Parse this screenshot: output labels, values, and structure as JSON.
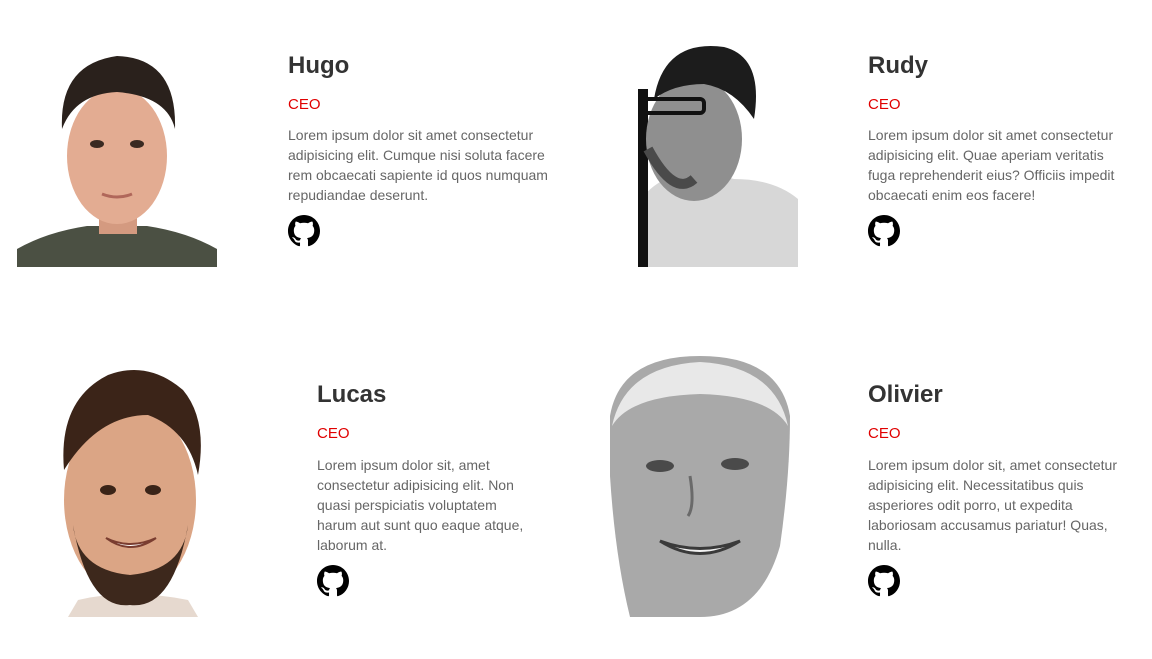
{
  "members": [
    {
      "name": "Hugo",
      "role": "CEO",
      "bio": "Lorem ipsum dolor sit amet consectetur adipisicing elit. Cumque nisi soluta facere rem obcaecati sapiente id quos numquam repudiandae deserunt.",
      "photo_alt": "Hugo portrait",
      "link_icon": "github-icon"
    },
    {
      "name": "Rudy",
      "role": "CEO",
      "bio": "Lorem ipsum dolor sit amet consectetur adipisicing elit. Quae aperiam veritatis fuga reprehenderit eius? Officiis impedit obcaecati enim eos facere!",
      "photo_alt": "Rudy portrait",
      "link_icon": "github-icon"
    },
    {
      "name": "Lucas",
      "role": "CEO",
      "bio": "Lorem ipsum dolor sit, amet consectetur adipisicing elit. Non quasi perspiciatis voluptatem harum aut sunt quo eaque atque, laborum at.",
      "photo_alt": "Lucas portrait",
      "link_icon": "github-icon"
    },
    {
      "name": "Olivier",
      "role": "CEO",
      "bio": "Lorem ipsum dolor sit, amet consectetur adipisicing elit. Necessitatibus quis asperiores odit porro, ut expedita laboriosam accusamus pariatur! Quas, nulla.",
      "photo_alt": "Olivier portrait",
      "link_icon": "github-icon"
    }
  ],
  "colors": {
    "accent": "#e00000",
    "heading": "#333333",
    "text": "#666666",
    "icon": "#000000"
  }
}
